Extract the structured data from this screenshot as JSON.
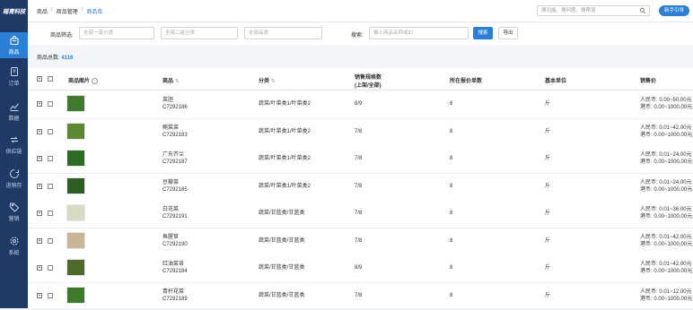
{
  "app": {
    "logo": "瑶青科技"
  },
  "sidebar": {
    "items": [
      {
        "label": "商品",
        "icon": "bag-icon",
        "active": true
      },
      {
        "label": "订单",
        "icon": "order-icon"
      },
      {
        "label": "数据",
        "icon": "chart-icon"
      },
      {
        "label": "供应链",
        "icon": "supply-icon"
      },
      {
        "label": "进销存",
        "icon": "inventory-icon"
      },
      {
        "label": "营销",
        "icon": "tag-icon"
      },
      {
        "label": "系统",
        "icon": "settings-icon"
      }
    ]
  },
  "header": {
    "breadcrumb": [
      "商品",
      "商品管理",
      "商品库"
    ],
    "search_placeholder": "搜功能、搜问题、搜帮误",
    "guide_button": "新手引导"
  },
  "filter": {
    "label": "商品筛选:",
    "select1": "全部一级分类",
    "select2": "全部二级分类",
    "select3": "全部品类",
    "search_label": "搜索:",
    "search_placeholder": "输入商品名称或ID",
    "search_button": "搜索",
    "export_button": "导出"
  },
  "total": {
    "label": "商品总数:",
    "value": "4116"
  },
  "table": {
    "headers": {
      "image": "商品图片",
      "product": "商品",
      "category": "分类",
      "sales_spec": "销售规格数",
      "sales_spec_sub": "(上架/全部)",
      "quote_count": "所在报价单数",
      "unit": "基本单位",
      "price": "销售价"
    },
    "rows": [
      {
        "name": "菜胆",
        "code": "C7292186",
        "category": "蔬菜/叶菜类1/叶菜类2",
        "spec": "8/9",
        "quotes": "8",
        "unit": "斤",
        "price1": "人民币: 0.00~50.00元",
        "price2": "港币: 0.00~1000.00元",
        "color": "#3f7a2e"
      },
      {
        "name": "鲍菜菜",
        "code": "C7292183",
        "category": "蔬菜/叶菜类1/叶菜类2",
        "spec": "7/8",
        "quotes": "8",
        "unit": "斤",
        "price1": "人民币: 0.01~42.00元",
        "price2": "港币: 0.00~1000.00元",
        "color": "#5c8a32"
      },
      {
        "name": "广东芥兰",
        "code": "C7292187",
        "category": "蔬菜/叶菜类1/叶菜类2",
        "spec": "7/8",
        "quotes": "8",
        "unit": "斤",
        "price1": "人民币: 0.01~24.00元",
        "price2": "港币: 0.00~1000.00元",
        "color": "#2e6b24"
      },
      {
        "name": "豆瓣菜",
        "code": "C7292185",
        "category": "蔬菜/叶菜类1/叶菜类2",
        "spec": "7/8",
        "quotes": "8",
        "unit": "斤",
        "price1": "人民币: 0.01~24.00元",
        "price2": "港币: 0.00~1000.00元",
        "color": "#2f5e22"
      },
      {
        "name": "白花菜",
        "code": "C7292191",
        "category": "蔬菜/甘蓝类/甘蓝类",
        "spec": "7/8",
        "quotes": "8",
        "unit": "斤",
        "price1": "人民币: 0.01~36.00元",
        "price2": "港币: 0.00~1000.00元",
        "color": "#d9dcc4"
      },
      {
        "name": "鱼腥草",
        "code": "C7292190",
        "category": "蔬菜/甘蓝类/甘蓝类",
        "spec": "7/8",
        "quotes": "8",
        "unit": "斤",
        "price1": "人民币: 0.01~42.00元",
        "price2": "港币: 0.00~1000.00元",
        "color": "#c9b597"
      },
      {
        "name": "红油菜苔",
        "code": "C7292184",
        "category": "蔬菜/甘蓝类/甘蓝类",
        "spec": "8/9",
        "quotes": "8",
        "unit": "斤",
        "price1": "人民币: 0.01~42.00元",
        "price2": "港币: 0.00~1000.00元",
        "color": "#4e6a2a"
      },
      {
        "name": "青杆花菜",
        "code": "C7292189",
        "category": "蔬菜/甘蓝类/甘蓝类",
        "spec": "7/8",
        "quotes": "8",
        "unit": "斤",
        "price1": "人民币: 0.01~12.00元",
        "price2": "港币: 0.00~1000.00元",
        "color": "#3d7a2c"
      }
    ]
  }
}
